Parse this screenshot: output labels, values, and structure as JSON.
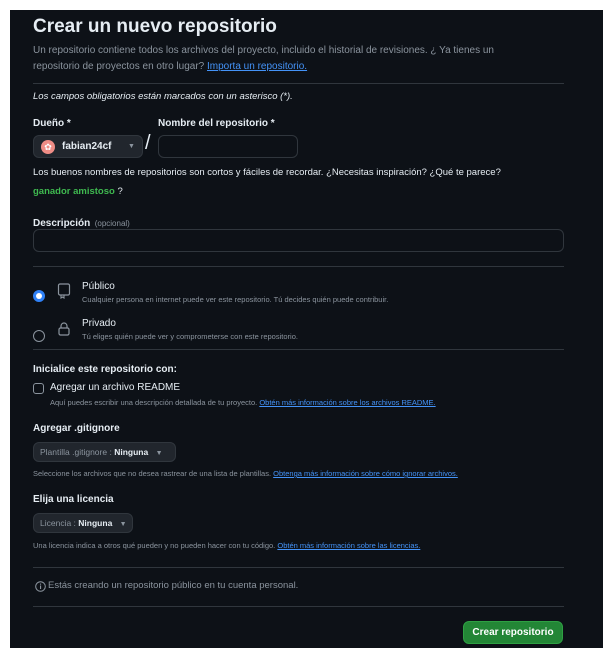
{
  "page": {
    "title": "Crear un nuevo repositorio",
    "intro_text": "Un repositorio contiene todos los archivos del proyecto, incluido el historial de revisiones. ¿ Ya tienes un repositorio de proyectos en otro lugar?",
    "import_link": "Importa un repositorio.",
    "required_note": "Los campos obligatorios están marcados con un asterisco (*)."
  },
  "owner": {
    "label": "Dueño *",
    "name": "fabian24cf",
    "avatar_icon": "identicon-avatar"
  },
  "repo_name": {
    "label": "Nombre del repositorio *",
    "separator": "/",
    "value": ""
  },
  "suggestion": {
    "text": "Los buenos nombres de repositorios son cortos y fáciles de recordar. ¿Necesitas inspiración? ¿Qué te parece?",
    "name": "ganador amistoso",
    "suffix": "?"
  },
  "description": {
    "label": "Descripción",
    "optional": "(opcional)",
    "value": ""
  },
  "visibility": {
    "public_title": "Público",
    "public_desc": "Cualquier persona en internet puede ver este repositorio. Tú decides quién puede contribuir.",
    "public_selected": true,
    "private_title": "Privado",
    "private_desc": "Tú eliges quién puede ver y comprometerse con este repositorio.",
    "private_selected": false
  },
  "initialize": {
    "heading": "Inicialice este repositorio con:",
    "readme_label": "Agregar un archivo README",
    "readme_checked": false,
    "readme_desc": "Aquí puedes escribir una descripción detallada de tu proyecto.",
    "readme_link": "Obtén más información sobre los archivos README."
  },
  "gitignore": {
    "heading": "Agregar .gitignore",
    "dropdown_prefix": "Plantilla .gitignore :",
    "dropdown_value": "Ninguna",
    "help": "Seleccione los archivos que no desea rastrear de una lista de plantillas.",
    "help_link": "Obtenga más información sobre cómo ignorar archivos."
  },
  "license": {
    "heading": "Elija una licencia",
    "dropdown_prefix": "Licencia :",
    "dropdown_value": "Ninguna",
    "help": "Una licencia indica a otros qué pueden y no pueden hacer con tu código.",
    "help_link": "Obtén más información sobre las licencias."
  },
  "info": {
    "icon": "info-icon",
    "text": "Estás creando un repositorio público en tu cuenta personal."
  },
  "actions": {
    "create_label": "Crear repositorio"
  },
  "colors": {
    "background": "#0d1117",
    "accent": "#4493f8",
    "primary_button": "#238636",
    "suggestion": "#3fb950"
  }
}
